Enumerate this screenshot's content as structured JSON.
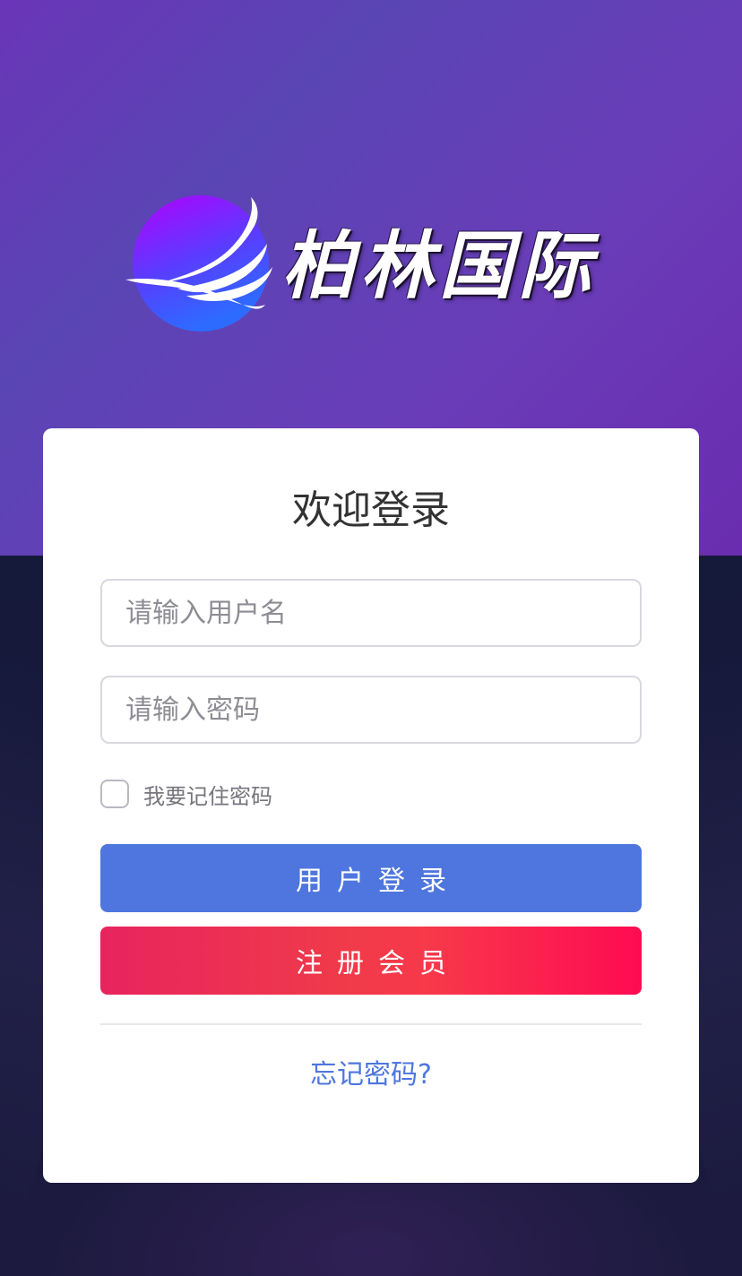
{
  "brand": {
    "logo_text": "柏林国际",
    "colors": {
      "sphere_top": "#b200ff",
      "sphere_bottom": "#2d6bff",
      "wing": "#ffffff"
    }
  },
  "login": {
    "title": "欢迎登录",
    "username_placeholder": "请输入用户名",
    "password_placeholder": "请输入密码",
    "remember_label": "我要记住密码",
    "login_button": "用户登录",
    "register_button": "注册会员",
    "forgot_link": "忘记密码?"
  },
  "theme": {
    "header_purple": "#6a35b8",
    "page_dark": "#161b3a",
    "primary_blue": "#4e76de",
    "register_red": "#f03a4a"
  }
}
